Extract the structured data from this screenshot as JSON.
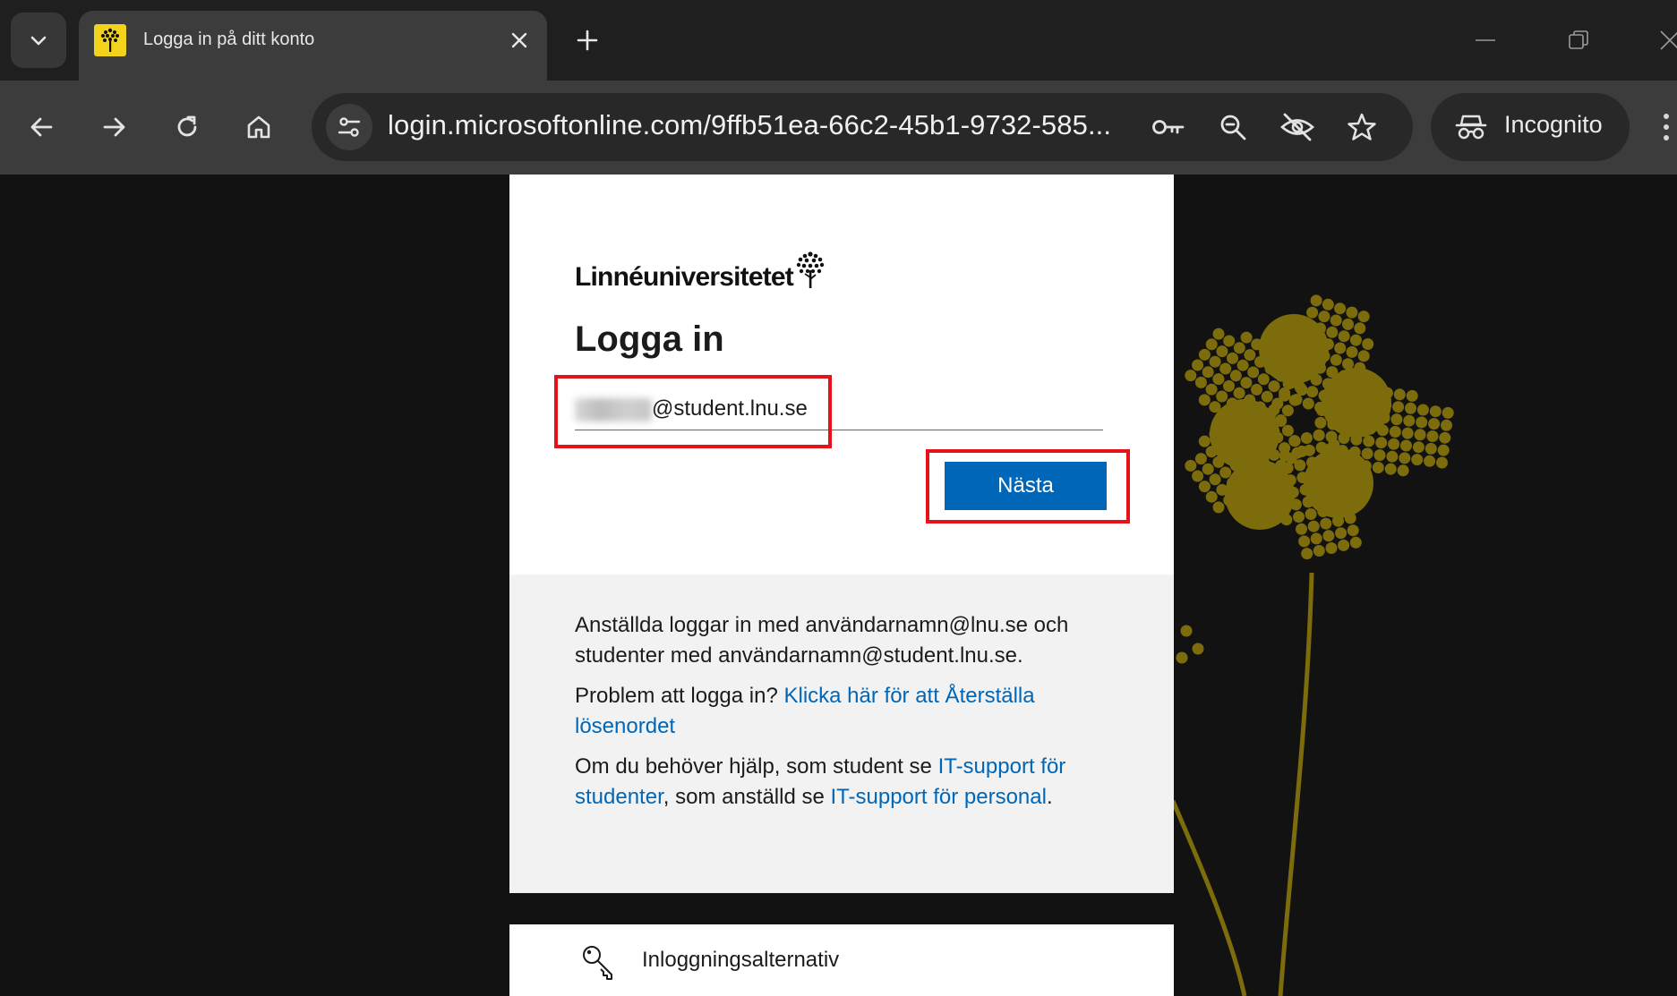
{
  "browser": {
    "tab": {
      "title": "Logga in på ditt konto",
      "favicon": "linnaeus-tree-icon"
    },
    "address_bar": {
      "url": "login.microsoftonline.com/9ffb51ea-66c2-45b1-9732-585..."
    },
    "incognito_label": "Incognito"
  },
  "page": {
    "logo_text": "Linnéuniversitetet",
    "heading": "Logga in",
    "email": {
      "visible_domain": "@student.lnu.se"
    },
    "next_button": "Nästa",
    "info": {
      "accounts_text": "Anställda loggar in med användarnamn@lnu.se och studenter med användarnamn@student.lnu.se.",
      "problem_prefix": "Problem att logga in? ",
      "reset_link": "Klicka här för att Återställa lösenordet",
      "help_prefix": "Om du behöver hjälp, som student se ",
      "student_support_link": "IT-support för studenter",
      "help_middle": ", som anställd se ",
      "staff_support_link": "IT-support för personal",
      "help_suffix": "."
    },
    "sign_in_options": "Inloggningsalternativ"
  },
  "colors": {
    "accent": "#0067b8",
    "highlight": "#e5121a",
    "flower": "#7d6c0c"
  }
}
